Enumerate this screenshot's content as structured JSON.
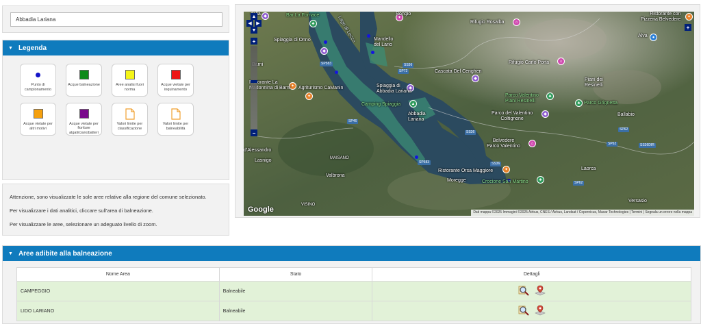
{
  "search": {
    "value": "Abbadia Lariana"
  },
  "legend": {
    "title": "Legenda",
    "items": [
      {
        "label": "Punto di campionamento",
        "symbol": "dot",
        "color": "#1414c8"
      },
      {
        "label": "Acque balneazione",
        "symbol": "square",
        "color": "#0e8a1a"
      },
      {
        "label": "Aree analisi fuori norma",
        "symbol": "square",
        "color": "#f5f518"
      },
      {
        "label": "Acque vietate per inquinamento",
        "symbol": "square",
        "color": "#ee1515"
      },
      {
        "label": "Acque vietate per altri motivi",
        "symbol": "square",
        "color": "#f5a00e"
      },
      {
        "label": "Acque vietate per fioriture algali/cianobatteri",
        "symbol": "square",
        "color": "#7a0a8c"
      },
      {
        "label": "Valori limite per classificazione",
        "symbol": "document-icon",
        "color": "#f0a030"
      },
      {
        "label": "Valori limite per balneabilità",
        "symbol": "document-icon",
        "color": "#f0a030"
      }
    ]
  },
  "info": {
    "line1": "Attenzione, sono visualizzate le sole aree relative alla regione del comune selezionato.",
    "line2": "Per visualizzare i dati analitici, cliccare sull'area di balneazione.",
    "line3": "Per visualizzare le aree, selezionare un adeguato livello di zoom."
  },
  "map": {
    "labels": {
      "bar_la_fornace": "Bar La Fornace",
      "rongio": "Rongio",
      "della": "della",
      "mandello": "Mandello\ndel Lario",
      "lago_di_lecco": "Lago di Lecco",
      "spiaggia_onno": "Spiaggia di Onno",
      "rifugio_rosalba": "Rifugio Rosalba",
      "ristorante_con": "Ristorante con\nPizzeria Belvedere",
      "alva": "Alva",
      "barni": "Barni",
      "cascata": "Cascata Del Cenghen",
      "rifugio_porta": "Rifugio Carlo Porta",
      "ristorante_la": "Ristorante La\nMadonnina di Barni",
      "agriturismo": "Agriturismo CaManin",
      "spiaggia_abbadia": "Spiaggia di\nAbbadia Lariana",
      "piani_resinelli": "Piani dei\nResinelli",
      "parco_valentino": "Parco Valentino\nPiani Resinelli",
      "parco_grignetta": "Parco Grignetta",
      "camping": "Camping Spiaggia",
      "abbadia": "Abbadia\nLariana",
      "parco_coltignone": "Parco del Valentino\nColtignone",
      "ballabio": "Ballabio",
      "alessandro": "d'Alessandro",
      "lasnigo": "Lasnigo",
      "belvedere": "Belvedere\nParco Valentino",
      "maisano": "MAISANO",
      "ristorante_orsa": "Ristorante Orsa Maggiore",
      "laorca": "Laorca",
      "valbrona": "Valbrona",
      "moregge": "Moregge",
      "crocione": "Crocione San Martino",
      "visino": "VISINO",
      "versasio": "Versasio"
    },
    "roads": [
      "SP583",
      "SS36",
      "SP72",
      "SP46",
      "SS36",
      "SP62",
      "SP62",
      "SS36DIR",
      "SP583",
      "SS36",
      "SP62"
    ],
    "google": "Google",
    "attribution": "Dati mappa ©2025 Immagini ©2025 Airbus, CNES / Airbus, Landsat / Copernicus, Maxar Technologies | Termini | Segnala un errore nella mappa"
  },
  "areas": {
    "title": "Aree adibite alla balneazione",
    "columns": [
      "Nome Area",
      "Stato",
      "Dettagli"
    ],
    "rows": [
      {
        "name": "CAMPEGGIO",
        "status": "Balneabile"
      },
      {
        "name": "LIDO LARIANO",
        "status": "Balneabile"
      }
    ]
  }
}
